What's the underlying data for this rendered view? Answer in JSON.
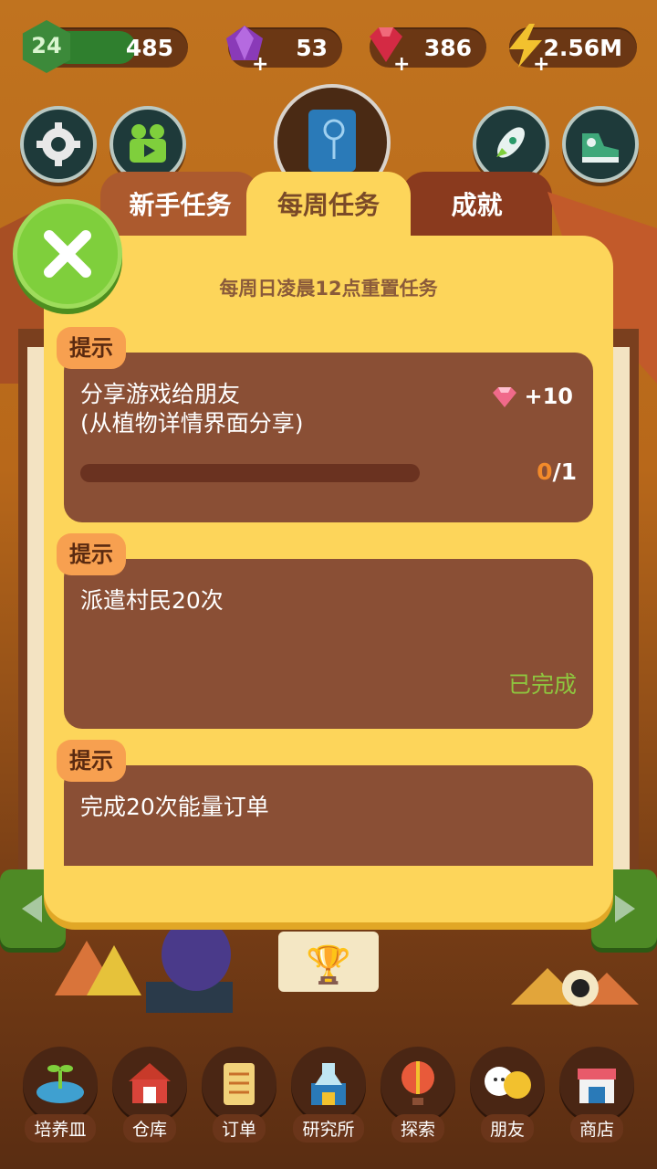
{
  "resources": {
    "level": "24",
    "exp": "485",
    "exp_fraction": 0.62,
    "gems": "53",
    "rubies": "386",
    "energy": "2.56M"
  },
  "colors": {
    "panel": "#fdd55a",
    "card": "#8a4f35",
    "accent": "#f28a2a",
    "done": "#8ec63f",
    "close": "#7fcf3c"
  },
  "tabs": [
    {
      "label": "新手任务",
      "active": false
    },
    {
      "label": "每周任务",
      "active": true
    },
    {
      "label": "成就",
      "active": false
    }
  ],
  "panel": {
    "subtitle": "每周日凌晨12点重置任务"
  },
  "tasks": [
    {
      "hint": "提示",
      "title": "分享游戏给朋友\n(从植物详情界面分享)",
      "reward": "+10",
      "progress_current": "0",
      "progress_total": "/1",
      "progress_fraction": 0
    },
    {
      "hint": "提示",
      "title": "派遣村民20次",
      "status": "已完成"
    },
    {
      "hint": "提示",
      "title": "完成20次能量订单"
    }
  ],
  "nav": [
    {
      "label": "培养皿",
      "icon": "petri-dish-icon"
    },
    {
      "label": "仓库",
      "icon": "barn-icon"
    },
    {
      "label": "订单",
      "icon": "scroll-icon"
    },
    {
      "label": "研究所",
      "icon": "lab-icon"
    },
    {
      "label": "探索",
      "icon": "balloon-icon"
    },
    {
      "label": "朋友",
      "icon": "friends-icon"
    },
    {
      "label": "商店",
      "icon": "shop-icon"
    }
  ]
}
